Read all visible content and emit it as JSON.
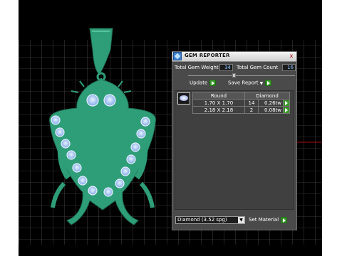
{
  "panel": {
    "title": "GEM REPORTER",
    "close_label": "x",
    "total_weight_label": "Total Gem Weight",
    "total_weight_value": "34",
    "total_count_label": "Total Gem Count",
    "total_count_value": "16",
    "update_label": "Update",
    "save_report_label": "Save Report",
    "table": {
      "headers": [
        "Round",
        "Diamond"
      ],
      "rows": [
        {
          "size": "1.70 X 1.70",
          "count": "14",
          "weight": "0.26tw"
        },
        {
          "size": "2.18 X 2.18",
          "count": "2",
          "weight": "0.08tw"
        }
      ]
    },
    "material_select_value": "Diamond   (3.52 spg)",
    "set_material_label": "Set Material"
  },
  "colors": {
    "pendant": "#2e9e78",
    "gem": "#9cc4f2",
    "grid": "#6e6e6e",
    "go_button": "#3a9a2a"
  }
}
